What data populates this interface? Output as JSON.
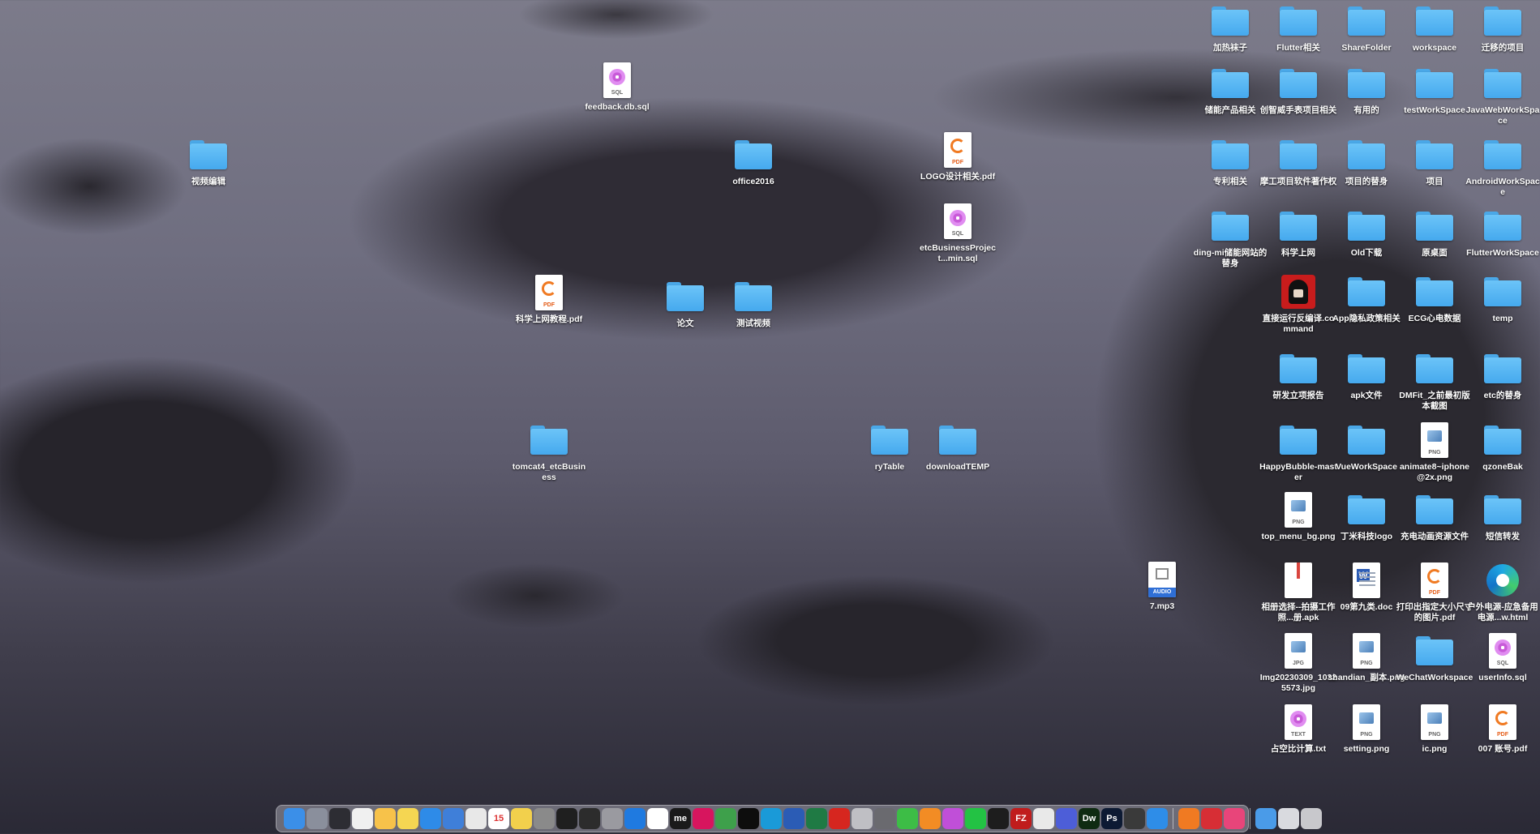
{
  "desktop_items": [
    {
      "label": "加热袜子",
      "kind": "folder",
      "name": "folder-jiare-wazi"
    },
    {
      "label": "Flutter相关",
      "kind": "folder",
      "name": "folder-flutter"
    },
    {
      "label": "ShareFolder",
      "kind": "folder",
      "name": "folder-sharefolder"
    },
    {
      "label": "workspace",
      "kind": "folder",
      "name": "folder-workspace"
    },
    {
      "label": "迁移的项目",
      "kind": "folder",
      "name": "folder-qianyi"
    },
    {
      "label": "储能产品相关",
      "kind": "folder",
      "name": "folder-chuneng"
    },
    {
      "label": "创智威手表项目相关",
      "kind": "folder",
      "name": "folder-chuangzhiwei"
    },
    {
      "label": "有用的",
      "kind": "folder",
      "name": "folder-youyong"
    },
    {
      "label": "testWorkSpace",
      "kind": "folder",
      "name": "folder-testworkspace"
    },
    {
      "label": "JavaWebWorkSpace",
      "kind": "folder",
      "name": "folder-javaweb"
    },
    {
      "label": "专利相关",
      "kind": "folder",
      "name": "folder-zhuanli"
    },
    {
      "label": "摩工项目软件著作权",
      "kind": "folder",
      "name": "folder-mogong"
    },
    {
      "label": "项目的替身",
      "kind": "folder",
      "name": "folder-xiangmu-alias"
    },
    {
      "label": "项目",
      "kind": "folder",
      "name": "folder-xiangmu"
    },
    {
      "label": "AndroidWorkSpace",
      "kind": "folder",
      "name": "folder-android"
    },
    {
      "label": "ding-mi储能网站的替身",
      "kind": "folder",
      "name": "folder-dingmi"
    },
    {
      "label": "科学上网",
      "kind": "folder",
      "name": "folder-kexue"
    },
    {
      "label": "Old下载",
      "kind": "folder",
      "name": "folder-old-download"
    },
    {
      "label": "原桌面",
      "kind": "folder",
      "name": "folder-yuan-zhuomian"
    },
    {
      "label": "FlutterWorkSpace",
      "kind": "folder",
      "name": "folder-flutterworkspace"
    },
    {
      "label": "直接运行反编译.command",
      "kind": "command",
      "name": "command-file"
    },
    {
      "label": "App隐私政策相关",
      "kind": "folder",
      "name": "folder-app-privacy"
    },
    {
      "label": "ECG心电数据",
      "kind": "folder",
      "name": "folder-ecg"
    },
    {
      "label": "temp",
      "kind": "folder",
      "name": "folder-temp"
    },
    {
      "label": "研发立项报告",
      "kind": "folder",
      "name": "folder-yanfa"
    },
    {
      "label": "apk文件",
      "kind": "folder",
      "name": "folder-apk"
    },
    {
      "label": "DMFit_之前最初版本截图",
      "kind": "folder",
      "name": "folder-dmfit"
    },
    {
      "label": "etc的替身",
      "kind": "folder",
      "name": "folder-etc-alias"
    },
    {
      "label": "HappyBubble-master",
      "kind": "folder",
      "name": "folder-happybubble"
    },
    {
      "label": "VueWorkSpace",
      "kind": "folder",
      "name": "folder-vue"
    },
    {
      "label": "animate8~iphone@2x.png",
      "kind": "png",
      "name": "file-animate8-png"
    },
    {
      "label": "qzoneBak",
      "kind": "folder",
      "name": "folder-qzonebak"
    },
    {
      "label": "top_menu_bg.png",
      "kind": "png",
      "name": "file-top-menu-png"
    },
    {
      "label": "丁米科技logo",
      "kind": "folder",
      "name": "folder-dingmi-logo"
    },
    {
      "label": "充电动画资源文件",
      "kind": "folder",
      "name": "folder-chongdian"
    },
    {
      "label": "短信转发",
      "kind": "folder",
      "name": "folder-duanxin"
    },
    {
      "label": "相册选择--拍摄工作照...册.apk",
      "kind": "apk",
      "name": "file-apk"
    },
    {
      "label": "09第九类.doc",
      "kind": "doc",
      "name": "file-doc"
    },
    {
      "label": "打印出指定大小尺寸的图片.pdf",
      "kind": "pdf",
      "name": "file-dayin-pdf"
    },
    {
      "label": "户外电源-应急备用电源...w.html",
      "kind": "html",
      "name": "file-html"
    },
    {
      "label": "Img20230309_10325573.jpg",
      "kind": "jpg",
      "name": "file-jpg"
    },
    {
      "label": "shandian_副本.png",
      "kind": "png",
      "name": "file-shandian-png"
    },
    {
      "label": "WeChatWorkspace",
      "kind": "folder",
      "name": "folder-wechat"
    },
    {
      "label": "userInfo.sql",
      "kind": "sql",
      "name": "file-userinfo-sql"
    },
    {
      "label": "占空比计算.txt",
      "kind": "txt",
      "name": "file-txt"
    },
    {
      "label": "setting.png",
      "kind": "png",
      "name": "file-setting-png"
    },
    {
      "label": "ic.png",
      "kind": "png",
      "name": "file-ic-png"
    },
    {
      "label": "007 账号.pdf",
      "kind": "pdf",
      "name": "file-007-pdf"
    },
    {
      "label": "feedback.db.sql",
      "kind": "sql",
      "name": "file-feedback-sql"
    },
    {
      "label": "视频编辑",
      "kind": "folder",
      "name": "folder-shipin-bianji"
    },
    {
      "label": "office2016",
      "kind": "folder",
      "name": "folder-office2016"
    },
    {
      "label": "LOGO设计相关.pdf",
      "kind": "pdf",
      "name": "file-logo-pdf"
    },
    {
      "label": "etcBusinessProject...min.sql",
      "kind": "sql",
      "name": "file-etc-sql"
    },
    {
      "label": "科学上网教程.pdf",
      "kind": "pdf",
      "name": "file-kexue-pdf"
    },
    {
      "label": "论文",
      "kind": "folder",
      "name": "folder-lunwen"
    },
    {
      "label": "测试视频",
      "kind": "folder",
      "name": "folder-ceshi-shipin"
    },
    {
      "label": "tomcat4_etcBusiness",
      "kind": "folder",
      "name": "folder-tomcat"
    },
    {
      "label": "ryTable",
      "kind": "folder",
      "name": "folder-rytable"
    },
    {
      "label": "downloadTEMP",
      "kind": "folder",
      "name": "folder-downloadtemp"
    },
    {
      "label": "7.mp3",
      "kind": "audio",
      "name": "file-mp3"
    }
  ],
  "file_tags": {
    "sql": "SQL",
    "pdf": "PDF",
    "png": "PNG",
    "jpg": "JPG",
    "txt": "TEXT",
    "audio": "AUDIO"
  },
  "dock": {
    "calendar_day": "15",
    "apps": [
      {
        "name": "finder-icon",
        "color": "#3b8fe8",
        "text": ""
      },
      {
        "name": "launchpad-icon",
        "color": "#8a8f9c",
        "text": ""
      },
      {
        "name": "mission-control-icon",
        "color": "#2d2d33",
        "text": ""
      },
      {
        "name": "typora-icon",
        "color": "#f0f0f0",
        "text": ""
      },
      {
        "name": "photos-icon",
        "color": "#f7c24a",
        "text": ""
      },
      {
        "name": "notes-icon",
        "color": "#f5d652",
        "text": ""
      },
      {
        "name": "safari-icon",
        "color": "#2e8be8",
        "text": ""
      },
      {
        "name": "cloud-icon",
        "color": "#3f7fd9",
        "text": ""
      },
      {
        "name": "chrome-icon",
        "color": "#e8e8e8",
        "text": ""
      },
      {
        "name": "calendar-icon",
        "color": "#ffffff",
        "text": "15"
      },
      {
        "name": "stickies-icon",
        "color": "#f2d04c",
        "text": ""
      },
      {
        "name": "settings-icon",
        "color": "#8a8a8a",
        "text": ""
      },
      {
        "name": "terminal-icon",
        "color": "#1f1f1f",
        "text": ""
      },
      {
        "name": "android-terminal-icon",
        "color": "#2c2c2c",
        "text": ""
      },
      {
        "name": "disk-utility-icon",
        "color": "#9a9aa0",
        "text": ""
      },
      {
        "name": "xcode-icon",
        "color": "#1f7ae0",
        "text": ""
      },
      {
        "name": "wps-icon",
        "color": "#ffffff",
        "text": ""
      },
      {
        "name": "me-app-icon",
        "color": "#1a1a1a",
        "text": "me"
      },
      {
        "name": "intellij-icon",
        "color": "#d7155e",
        "text": ""
      },
      {
        "name": "android-studio-icon",
        "color": "#3ea04b",
        "text": ""
      },
      {
        "name": "webstorm-icon",
        "color": "#0d0d0d",
        "text": ""
      },
      {
        "name": "edge-icon",
        "color": "#1a9ad8",
        "text": ""
      },
      {
        "name": "word-icon",
        "color": "#2b5cb5",
        "text": ""
      },
      {
        "name": "excel-icon",
        "color": "#1f7a44",
        "text": ""
      },
      {
        "name": "netease-icon",
        "color": "#d6261f",
        "text": ""
      },
      {
        "name": "keyboard-icon",
        "color": "#bfbfc4",
        "text": ""
      },
      {
        "name": "calculator-icon",
        "color": "#6a6a6f",
        "text": ""
      },
      {
        "name": "app-green-icon",
        "color": "#3dbd46",
        "text": ""
      },
      {
        "name": "sublime-icon",
        "color": "#f28c24",
        "text": ""
      },
      {
        "name": "flower-icon",
        "color": "#c04fd8",
        "text": ""
      },
      {
        "name": "wechat-icon",
        "color": "#23c244",
        "text": ""
      },
      {
        "name": "qq-icon",
        "color": "#1d1d1d",
        "text": ""
      },
      {
        "name": "filezilla-icon",
        "color": "#c01c1c",
        "text": "FZ"
      },
      {
        "name": "chrome-alt-icon",
        "color": "#e9e9e9",
        "text": ""
      },
      {
        "name": "screen-sharing-icon",
        "color": "#4d5ed8",
        "text": ""
      },
      {
        "name": "dreamweaver-icon",
        "color": "#0f2b12",
        "text": "Dw"
      },
      {
        "name": "photoshop-icon",
        "color": "#0d1a33",
        "text": "Ps"
      },
      {
        "name": "arch-icon",
        "color": "#3a3a3a",
        "text": ""
      },
      {
        "name": "folder-app-icon",
        "color": "#2e8de8",
        "text": ""
      }
    ],
    "apps_right": [
      {
        "name": "pdf-expert-icon",
        "color": "#f07a22",
        "text": ""
      },
      {
        "name": "toolbox-icon",
        "color": "#d72e35",
        "text": ""
      },
      {
        "name": "scrubber-icon",
        "color": "#e8457a",
        "text": ""
      }
    ],
    "apps_tray": [
      {
        "name": "screenshot-icon",
        "color": "#4a9be8",
        "text": ""
      },
      {
        "name": "drive-icon",
        "color": "#d9dadf",
        "text": ""
      },
      {
        "name": "trash-icon",
        "color": "#c8c8cc",
        "text": ""
      }
    ]
  }
}
